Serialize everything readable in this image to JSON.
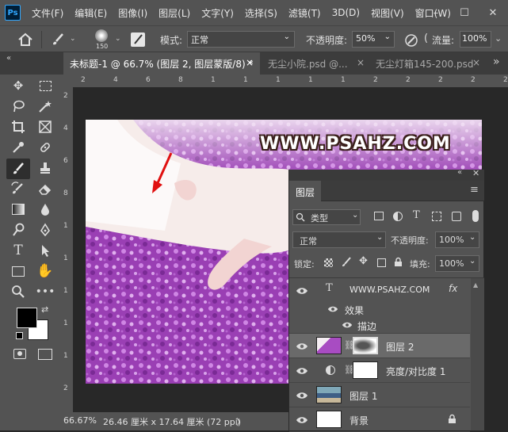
{
  "app": {
    "logo": "Ps",
    "menu": [
      "文件(F)",
      "编辑(E)",
      "图像(I)",
      "图层(L)",
      "文字(Y)",
      "选择(S)",
      "滤镜(T)",
      "3D(D)",
      "视图(V)",
      "窗口(W)"
    ],
    "window_buttons": [
      "–",
      "☐",
      "✕"
    ]
  },
  "options_bar": {
    "brush_size": "150",
    "mode_label": "模式:",
    "mode_value": "正常",
    "opacity_label": "不透明度:",
    "opacity_value": "50%",
    "flow_label": "流量:",
    "flow_value": "100%"
  },
  "tabs": [
    {
      "label": "未标题-1 @ 66.7% (图层 2, 图层蒙版/8) *",
      "close": "×"
    },
    {
      "label": "无尘小院.psd @...",
      "close": "×"
    },
    {
      "label": "无尘灯箱145-200.psd",
      "close": "×"
    }
  ],
  "tab_overflow": "»",
  "panel_collapse": "«",
  "rulers": {
    "h": [
      "2",
      "4",
      "6",
      "8",
      "1",
      "1",
      "1",
      "1",
      "1",
      "2",
      "2",
      "2",
      "2",
      "2"
    ],
    "v": [
      "2",
      "4",
      "6",
      "8",
      "1",
      "1",
      "1",
      "1",
      "1",
      "2"
    ]
  },
  "document": {
    "watermark": "WWW.PSAHZ.COM"
  },
  "status_bar": {
    "zoom": "66.67%",
    "doc_size": "26.46 厘米 x 17.64 厘米 (72 ppi)",
    "arrow": "〉"
  },
  "layers_panel": {
    "title": "图层",
    "filter_kind": "类型",
    "blend_mode": "正常",
    "opacity_label": "不透明度:",
    "opacity_value": "100%",
    "lock_label": "锁定:",
    "fill_label": "填充:",
    "fill_value": "100%",
    "layers": [
      {
        "name": "WWW.PSAHZ.COM",
        "type": "text",
        "fx": "fx"
      },
      {
        "name": "效果",
        "type": "effects"
      },
      {
        "name": "描边",
        "type": "effect"
      },
      {
        "name": "图层 2",
        "type": "pixel-with-mask",
        "selected": true
      },
      {
        "name": "亮度/对比度 1",
        "type": "adjustment"
      },
      {
        "name": "图层 1",
        "type": "pixel"
      },
      {
        "name": "背景",
        "type": "background",
        "locked": true
      }
    ]
  },
  "colors": {
    "foreground": "#000000",
    "background": "#ffffff",
    "accent": "#31a8ff"
  }
}
